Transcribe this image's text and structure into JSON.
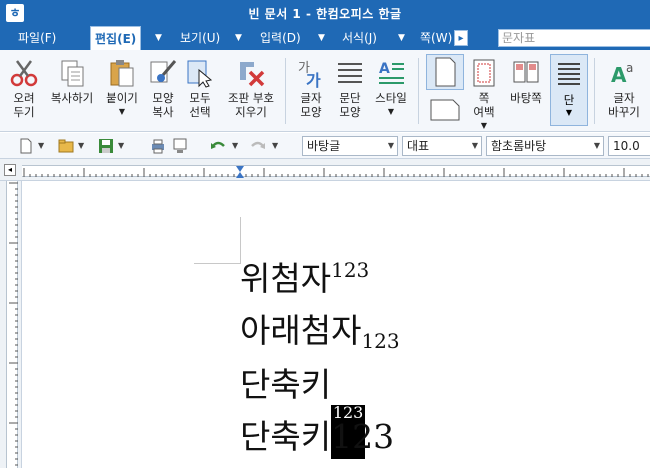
{
  "window": {
    "title": "빈 문서 1 - 한컴오피스 한글",
    "app_icon": "ㅎ"
  },
  "menu": {
    "tabs": [
      {
        "label": "파일(F)"
      },
      {
        "label": "편집(E)"
      },
      {
        "label": "보기(U)"
      },
      {
        "label": "입력(D)"
      },
      {
        "label": "서식(J)"
      },
      {
        "label": "쪽(W)"
      }
    ],
    "more_glyph": "▸",
    "style_search_placeholder": "문자표"
  },
  "ribbon": {
    "cut": "오려\n두기",
    "copy": "복사하기",
    "paste": "붙이기",
    "format_copy": "모양\n복사",
    "select_all": "모두\n선택",
    "symbols": "조판 부호\n지우기",
    "char_shape": "글자\n모양",
    "para_shape": "문단\n모양",
    "style": "스타일",
    "page_margin": "쪽\n여백",
    "background_page": "바탕쪽",
    "columns": "단",
    "change_case": "글자\n바꾸기"
  },
  "toolbar": {
    "style_combo": "바탕글",
    "lang_combo": "대표",
    "font_combo": "함초롬바탕",
    "size_combo": "10.0"
  },
  "document": {
    "lines": [
      {
        "base": "위첨자",
        "script": "123",
        "mode": "sup"
      },
      {
        "base": "아래첨자",
        "script": "123",
        "mode": "sub"
      },
      {
        "base": "단축키",
        "script": "123",
        "mode": "selected"
      },
      {
        "base": "단축키",
        "script": "123",
        "mode": "normal"
      }
    ]
  },
  "colors": {
    "accent": "#1f69b5",
    "ribbon_bg": "#f4f7fb"
  }
}
